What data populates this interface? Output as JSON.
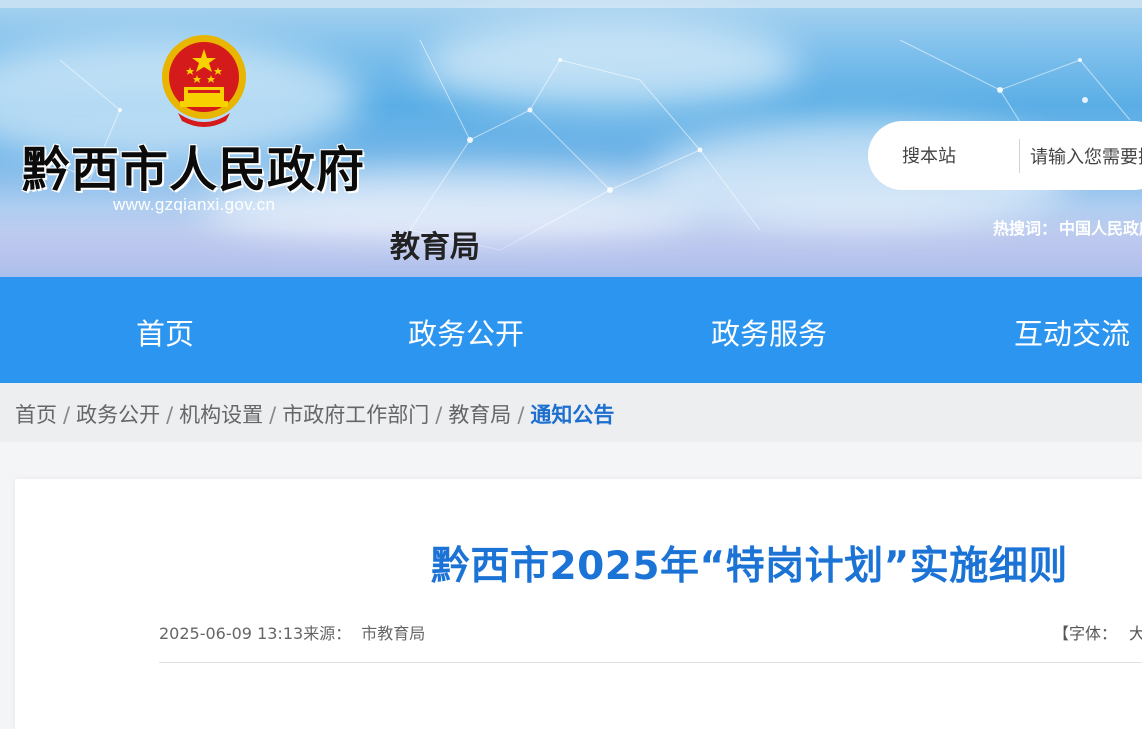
{
  "header": {
    "site_title": "黔西市人民政府",
    "site_url": "www.gzqianxi.gov.cn",
    "dept_name": "教育局",
    "search": {
      "scope_label": "搜本站",
      "placeholder": "请输入您需要搜索的内容"
    },
    "hot_words": {
      "label": "热搜词：",
      "items": [
        "中国人民政府"
      ]
    }
  },
  "nav": {
    "items": [
      {
        "label": "首页"
      },
      {
        "label": "政务公开"
      },
      {
        "label": "政务服务"
      },
      {
        "label": "互动交流"
      }
    ]
  },
  "breadcrumb": {
    "items": [
      "首页",
      "政务公开",
      "机构设置",
      "市政府工作部门",
      "教育局"
    ],
    "current": "通知公告",
    "separator": "/"
  },
  "article": {
    "title": "黔西市2025年“特岗计划”实施细则",
    "datetime": "2025-06-09 13:13",
    "source_label": "来源：",
    "source": "市教育局",
    "font_size_label": "【字体：",
    "font_size_options": [
      "大"
    ]
  },
  "colors": {
    "nav_bg": "#2b95f0",
    "title_blue": "#1c73d6",
    "breadcrumb_current": "#1d6fcf"
  }
}
